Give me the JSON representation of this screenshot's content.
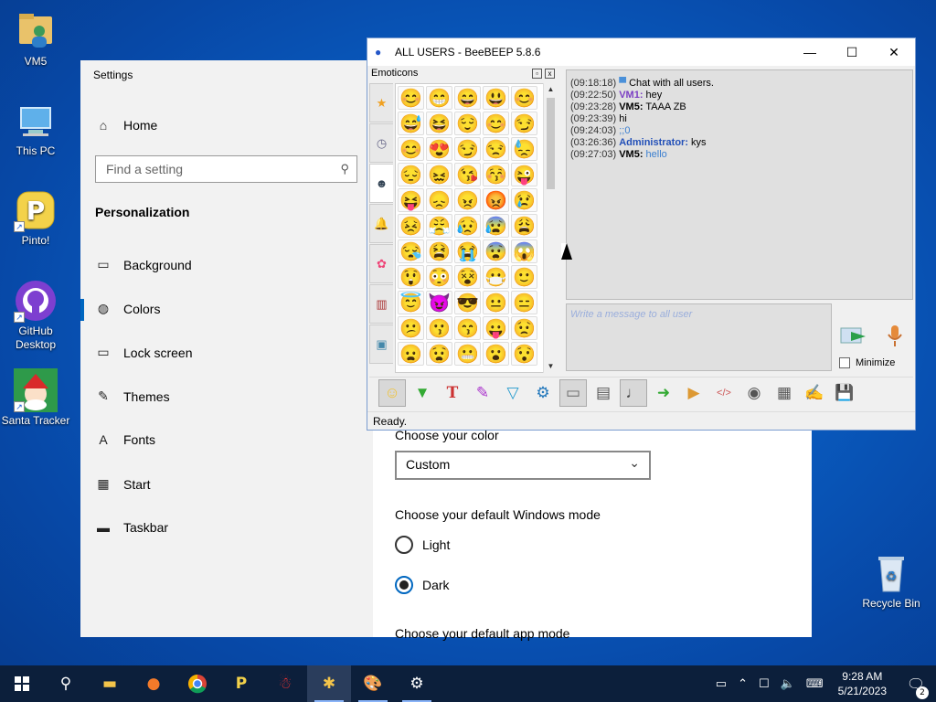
{
  "desktop": {
    "icons": [
      {
        "label": "VM5",
        "icon": "user-folder-icon"
      },
      {
        "label": "This PC",
        "icon": "computer-icon"
      },
      {
        "label": "Pinto!",
        "icon": "pinto-icon"
      },
      {
        "label": "GitHub Desktop",
        "icon": "github-icon"
      },
      {
        "label": "Santa Tracker",
        "icon": "santa-icon"
      },
      {
        "label": "Recycle Bin",
        "icon": "recycle-bin-icon"
      }
    ]
  },
  "settings": {
    "title": "Settings",
    "home": "Home",
    "search_placeholder": "Find a setting",
    "section": "Personalization",
    "nav": [
      "Background",
      "Colors",
      "Lock screen",
      "Themes",
      "Fonts",
      "Start",
      "Taskbar"
    ],
    "selected": "Colors",
    "choose_color_label": "Choose your color",
    "color_value": "Custom",
    "windows_mode_label": "Choose your default Windows mode",
    "modes": [
      "Light",
      "Dark"
    ],
    "selected_mode": "Dark",
    "app_mode_label": "Choose your default app mode"
  },
  "beebeep": {
    "title": "ALL USERS - BeeBEEP 5.8.6",
    "emoticons_label": "Emoticons",
    "emoji_grid": [
      "😊",
      "😁",
      "😄",
      "😃",
      "😊",
      "😅",
      "😆",
      "😌",
      "😊",
      "😏",
      "😊",
      "😍",
      "😏",
      "😒",
      "😓",
      "😔",
      "😖",
      "😘",
      "😚",
      "😜",
      "😝",
      "😞",
      "😠",
      "😡",
      "😢",
      "😣",
      "😤",
      "😥",
      "😰",
      "😩",
      "😪",
      "😫",
      "😭",
      "😨",
      "😱",
      "😲",
      "😳",
      "😵",
      "😷",
      "🙂",
      "😇",
      "😈",
      "😎",
      "😐",
      "😑",
      "😕",
      "😗",
      "😙",
      "😛",
      "😟",
      "😦",
      "😧",
      "😬",
      "😮",
      "😯"
    ],
    "chat": [
      {
        "time": "(09:18:18)",
        "user": "",
        "text": "Chat with all users.",
        "kind": "system"
      },
      {
        "time": "(09:22:50)",
        "user": "VM1:",
        "text": "hey",
        "kind": "vm1"
      },
      {
        "time": "(09:23:28)",
        "user": "VM5:",
        "text": "TAAA ZB",
        "kind": "vm5"
      },
      {
        "time": "(09:23:39)",
        "user": "",
        "text": "hi",
        "kind": "plain"
      },
      {
        "time": "(09:24:03)",
        "user": "",
        "text": ";;0",
        "kind": "link"
      },
      {
        "time": "(03:26:36)",
        "user": "Administrator:",
        "text": "kys",
        "kind": "admin"
      },
      {
        "time": "(09:27:03)",
        "user": "VM5:",
        "text": "hello",
        "kind": "vm5link"
      }
    ],
    "message_placeholder": "Write a message to all user",
    "minimize_label": "Minimize",
    "status": "Ready.",
    "colors": {
      "vm1": "#7b3fc4",
      "vm5": "#000000",
      "admin": "#2350b8",
      "link": "#3b7fd0"
    }
  },
  "taskbar": {
    "time": "9:28 AM",
    "date": "5/21/2023",
    "notifications": "2"
  }
}
